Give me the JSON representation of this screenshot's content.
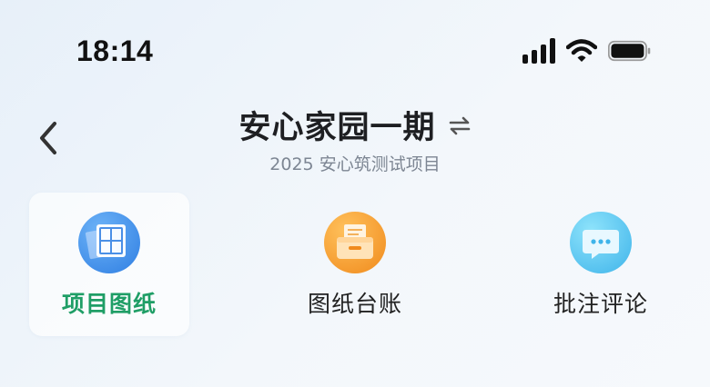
{
  "status_bar": {
    "time": "18:14",
    "icons": [
      "signal-icon",
      "wifi-icon",
      "battery-icon"
    ]
  },
  "header": {
    "title": "安心家园一期",
    "subtitle": "2025 安心筑测试项目",
    "icons": [
      "back-arrow-icon",
      "switch-arrows-icon"
    ]
  },
  "menu": {
    "items": [
      {
        "label": "项目图纸",
        "icon": "blueprint-icon",
        "active": true
      },
      {
        "label": "图纸台账",
        "icon": "file-drawer-icon",
        "active": false
      },
      {
        "label": "批注评论",
        "icon": "chat-bubble-icon",
        "active": false
      }
    ]
  },
  "colors": {
    "active_label": "#1f9e66",
    "blueprint_icon": "#3a8ee8",
    "drawer_icon": "#f59a2a",
    "chat_icon": "#4fc3ee"
  }
}
